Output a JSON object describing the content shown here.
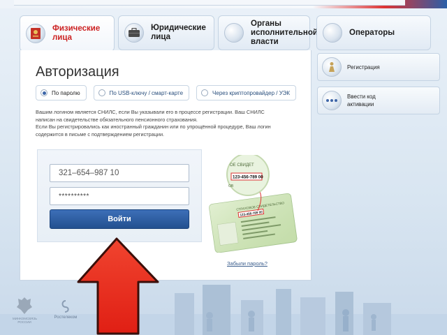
{
  "tabs": [
    {
      "label": "Физические лица",
      "icon": "passport-icon",
      "active": true
    },
    {
      "label": "Юридические лица",
      "icon": "briefcase-icon",
      "active": false
    },
    {
      "label": "Органы исполнительной власти",
      "icon": "government-icon",
      "active": false
    },
    {
      "label": "Операторы",
      "icon": "operator-icon",
      "active": false
    }
  ],
  "auth": {
    "title": "Авторизация",
    "methods": [
      {
        "label": "По паролю",
        "selected": true
      },
      {
        "label": "По USB-ключу / смарт-карте",
        "selected": false
      },
      {
        "label": "Через криптопровайдер / УЭК",
        "selected": false
      }
    ],
    "info_line1": "Вашим логином является СНИЛС, если Вы указывали его в процессе регистрации. Ваш СНИЛС",
    "info_line2": "написан на свидетельстве обязательного пенсионного страхования.",
    "info_line3": "Если Вы регистрировались как иностранный гражданин или по упрощённой процедуре, Ваш логин",
    "info_line4": "содержится в письме с подтверждением регистрации.",
    "login_value": "321–654–987 10",
    "password_value": "**********",
    "submit_label": "Войти",
    "forgot_label": "Забыли пароль?"
  },
  "card": {
    "zoom_number": "123-456-789 00",
    "zoom_header": "ОЕ СВИДЕТ",
    "zoom_sub": "ОВ",
    "card_title": "СТРАХОВОЕ СВИДЕТЕЛЬСТВО",
    "card_number": "123-456-789 00"
  },
  "sidebar": {
    "items": [
      {
        "label": "Регистрация",
        "icon": "registration-icon"
      },
      {
        "label": "Ввести код активации",
        "icon": "activation-code-icon"
      }
    ]
  },
  "footer": {
    "logo1_label": "МИНКОМСВЯЗЬ РОССИИ",
    "logo2_label": "Ростелеком"
  },
  "colors": {
    "accent_red": "#cc2222",
    "primary_blue": "#23508f",
    "arrow_red": "#e8261c"
  }
}
